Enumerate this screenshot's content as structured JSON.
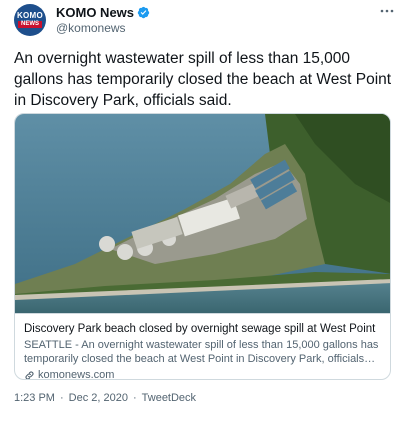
{
  "account": {
    "display_name": "KOMO News",
    "handle": "@komonews",
    "avatar_text_top": "KOMO",
    "avatar_text_bottom": "NEWS",
    "verified_color": "#1d9bf0",
    "brand_blue": "#1e4f8c",
    "brand_red": "#c8102e"
  },
  "menu": {
    "icon": "more-icon"
  },
  "tweet": {
    "text": "An overnight wastewater spill of less than 15,000 gallons has temporarily closed the beach at West Point in Discovery Park, officials said."
  },
  "card": {
    "title": "Discovery Park beach closed by overnight sewage spill at West Point",
    "description": "SEATTLE - An overnight wastewater spill of less than 15,000 gallons has temporarily closed the beach at West Point in Discovery Park, officials said. The spill took plac...",
    "domain": "komonews.com",
    "link_icon": "link-icon"
  },
  "meta": {
    "time": "1:23 PM",
    "date": "Dec 2, 2020",
    "source": "TweetDeck",
    "separator": "·"
  }
}
